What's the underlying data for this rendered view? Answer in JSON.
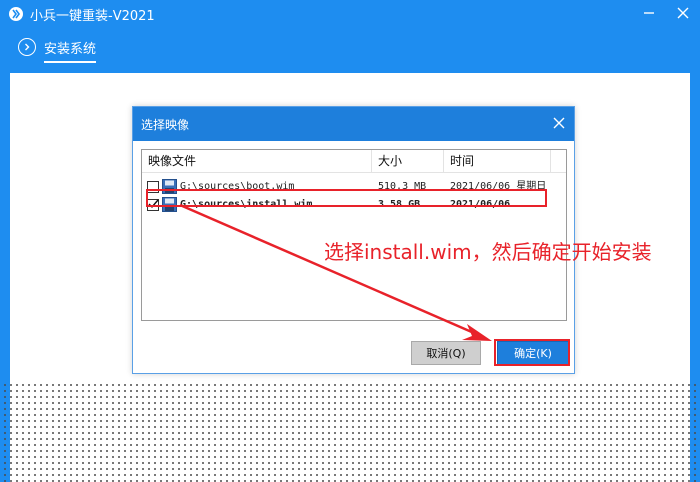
{
  "app": {
    "title": "小兵一键重装-V2021",
    "accent": "#1e8df0"
  },
  "nav": {
    "tabs": [
      {
        "label": "安装系统",
        "icon": "chevron-right-circle-icon",
        "active": true
      }
    ]
  },
  "dialog": {
    "title": "选择映像",
    "columns": [
      "映像文件",
      "大小",
      "时间"
    ],
    "rows": [
      {
        "checked": false,
        "icon": "disk-image-icon",
        "file": "G:\\sources\\boot.wim",
        "size": "510.3 MB",
        "time": "2021/06/06  星期日"
      },
      {
        "checked": true,
        "icon": "disk-image-icon",
        "file": "G:\\sources\\install.wim",
        "size": "3.58 GB",
        "time": "2021/06/06  ..."
      }
    ],
    "cancel_label": "取消(Q)",
    "ok_label": "确定(K)"
  },
  "annotation": {
    "text": "选择install.wim，然后确定开始安装",
    "color": "#e8222a"
  }
}
